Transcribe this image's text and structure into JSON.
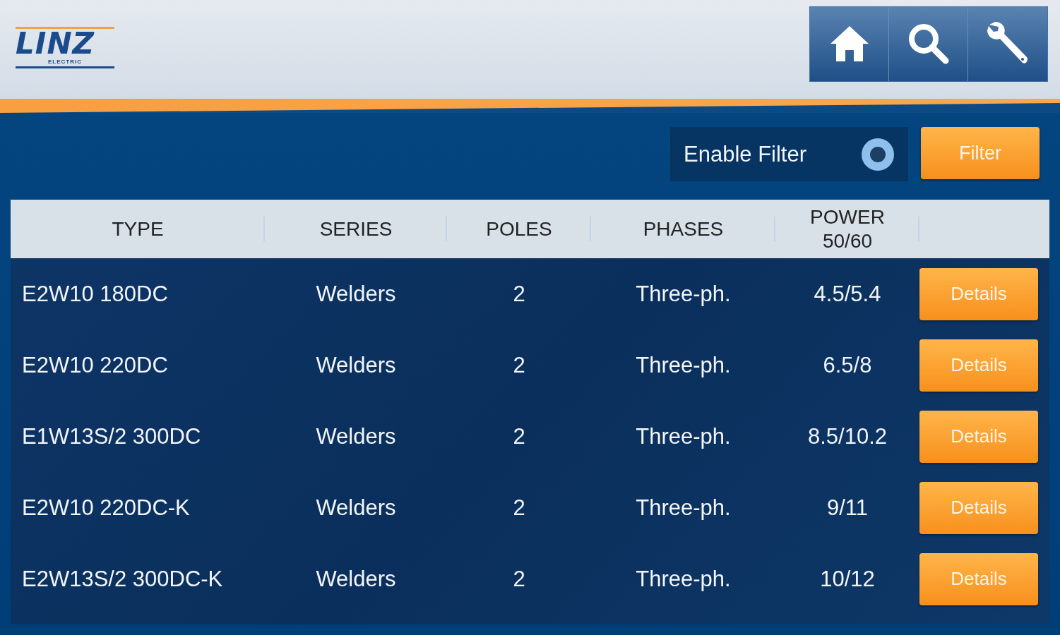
{
  "header": {
    "logo": {
      "name": "LINZ",
      "tagline": "ELECTRIC"
    },
    "nav_buttons": [
      {
        "kind": "home"
      },
      {
        "kind": "search"
      },
      {
        "kind": "settings"
      }
    ]
  },
  "filter_bar": {
    "enable_filter": {
      "label": "Enable Filter",
      "checked": false
    },
    "button": "Filter"
  },
  "table": {
    "columns": [
      "TYPE",
      "SERIES",
      "POLES",
      "PHASES",
      "POWER 50/60"
    ],
    "rows": [
      {
        "type": "E2W10 180DC",
        "series": "Welders",
        "poles": "2",
        "phases": "Three-ph.",
        "power": "4.5/5.4",
        "action": "Details"
      },
      {
        "type": "E2W10 220DC",
        "series": "Welders",
        "poles": "2",
        "phases": "Three-ph.",
        "power": "6.5/8",
        "action": "Details"
      },
      {
        "type": "E1W13S/2 300DC",
        "series": "Welders",
        "poles": "2",
        "phases": "Three-ph.",
        "power": "8.5/10.2",
        "action": "Details"
      },
      {
        "type": "E2W10 220DC-K",
        "series": "Welders",
        "poles": "2",
        "phases": "Three-ph.",
        "power": "9/11",
        "action": "Details"
      },
      {
        "type": "E2W13S/2 300DC-K",
        "series": "Welders",
        "poles": "2",
        "phases": "Three-ph.",
        "power": "10/12",
        "action": "Details"
      }
    ]
  }
}
